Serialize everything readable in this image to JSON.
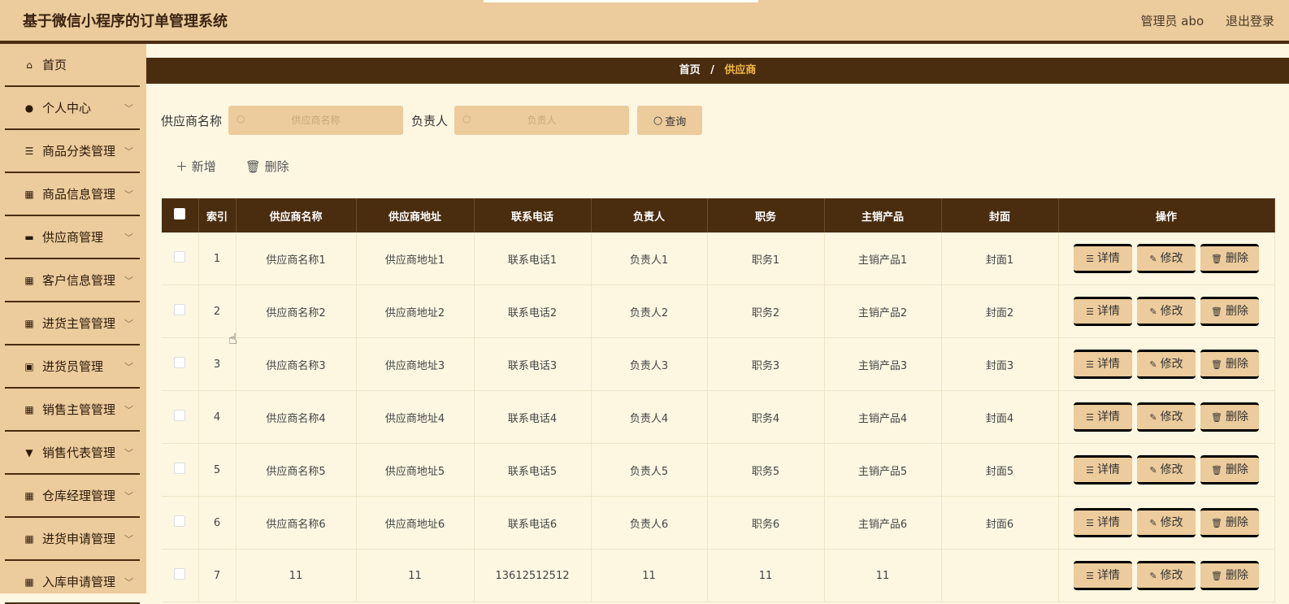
{
  "header": {
    "title": "基于微信小程序的订单管理系统",
    "user": "管理员 abo",
    "logout": "退出登录"
  },
  "sidebar": {
    "items": [
      {
        "label": "首页",
        "icon": "home-icon"
      },
      {
        "label": "个人中心",
        "icon": "person-icon"
      },
      {
        "label": "商品分类管理",
        "icon": "list-icon"
      },
      {
        "label": "商品信息管理",
        "icon": "grid-icon"
      },
      {
        "label": "供应商管理",
        "icon": "monitor-icon"
      },
      {
        "label": "客户信息管理",
        "icon": "grid-icon"
      },
      {
        "label": "进货主管管理",
        "icon": "grid-icon"
      },
      {
        "label": "进货员管理",
        "icon": "clipboard-icon"
      },
      {
        "label": "销售主管管理",
        "icon": "grid-icon"
      },
      {
        "label": "销售代表管理",
        "icon": "stamp-icon"
      },
      {
        "label": "仓库经理管理",
        "icon": "apps-icon"
      },
      {
        "label": "进货申请管理",
        "icon": "grid-icon"
      },
      {
        "label": "入库申请管理",
        "icon": "grid-icon"
      }
    ]
  },
  "breadcrumb": {
    "home": "首页",
    "sep": "/",
    "current": "供应商"
  },
  "search": {
    "name_label": "供应商名称",
    "name_placeholder": "供应商名称",
    "person_label": "负责人",
    "person_placeholder": "负责人",
    "query": "查询"
  },
  "actions": {
    "add": "新增",
    "delete": "删除"
  },
  "table": {
    "headers": [
      "索引",
      "供应商名称",
      "供应商地址",
      "联系电话",
      "负责人",
      "职务",
      "主销产品",
      "封面",
      "操作"
    ],
    "rows": [
      [
        "1",
        "供应商名称1",
        "供应商地址1",
        "联系电话1",
        "负责人1",
        "职务1",
        "主销产品1",
        "封面1"
      ],
      [
        "2",
        "供应商名称2",
        "供应商地址2",
        "联系电话2",
        "负责人2",
        "职务2",
        "主销产品2",
        "封面2"
      ],
      [
        "3",
        "供应商名称3",
        "供应商地址3",
        "联系电话3",
        "负责人3",
        "职务3",
        "主销产品3",
        "封面3"
      ],
      [
        "4",
        "供应商名称4",
        "供应商地址4",
        "联系电话4",
        "负责人4",
        "职务4",
        "主销产品4",
        "封面4"
      ],
      [
        "5",
        "供应商名称5",
        "供应商地址5",
        "联系电话5",
        "负责人5",
        "职务5",
        "主销产品5",
        "封面5"
      ],
      [
        "6",
        "供应商名称6",
        "供应商地址6",
        "联系电话6",
        "负责人6",
        "职务6",
        "主销产品6",
        "封面6"
      ],
      [
        "7",
        "11",
        "11",
        "13612512512",
        "11",
        "11",
        "11",
        ""
      ]
    ],
    "ops": {
      "detail": "详情",
      "edit": "修改",
      "delete": "删除"
    }
  }
}
